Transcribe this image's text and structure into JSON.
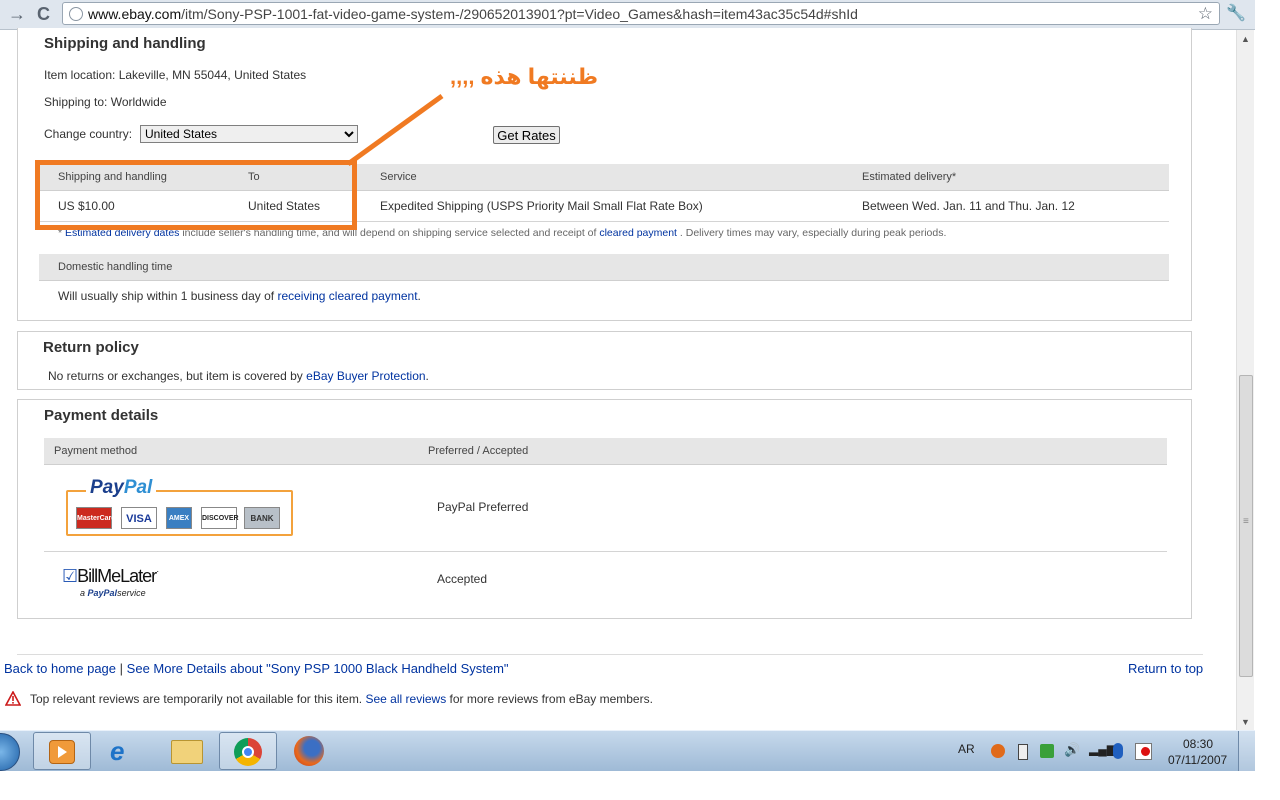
{
  "browser": {
    "url_host": "www.ebay.com",
    "url_path": "/itm/Sony-PSP-1001-fat-video-game-system-/290652013901?pt=Video_Games&hash=item43ac35c54d#shId",
    "back_glyph": "→",
    "reload_glyph": "C"
  },
  "shipping": {
    "title": "Shipping and handling",
    "item_location": "Item location: Lakeville, MN 55044, United States",
    "shipping_to": "Shipping to: Worldwide",
    "change_country_label": "Change country:",
    "selected_country": "United States",
    "get_rates_label": "Get Rates",
    "table": {
      "headers": [
        "Shipping and handling",
        "To",
        "Service",
        "Estimated delivery*"
      ],
      "row": [
        "US $10.00",
        "United States",
        "Expedited Shipping (USPS Priority Mail Small Flat Rate Box)",
        "Between Wed. Jan. 11 and Thu. Jan. 12"
      ]
    },
    "note_star": "*",
    "note_link1": "Estimated delivery dates",
    "note_mid": "include seller's handling time, and will depend on shipping service selected and receipt of",
    "note_link2": "cleared payment",
    "note_end": ". Delivery times may vary, especially during peak periods.",
    "domestic_header": "Domestic handling time",
    "domestic_text": "Will usually ship within 1 business day of",
    "domestic_link": "receiving cleared payment",
    "domestic_end": "."
  },
  "annotation": {
    "text": "ظننتها هذه ,,,,",
    "color": "#f07a22"
  },
  "return_policy": {
    "title": "Return policy",
    "text": "No returns or exchanges, but item is covered by",
    "link": "eBay Buyer Protection",
    "end": "."
  },
  "payment": {
    "title": "Payment details",
    "headers": [
      "Payment method",
      "Preferred / Accepted"
    ],
    "paypal_logo_text_a": "Pay",
    "paypal_logo_text_b": "Pal",
    "cards": [
      "MasterCard",
      "VISA",
      "AMEX",
      "DISCOVER",
      "BANK"
    ],
    "paypal_status": "PayPal Preferred",
    "bml_logo_text": "BillMeLater",
    "bml_sub_a": "a",
    "bml_sub_b": "PayPal",
    "bml_sub_c": "service",
    "bml_status": "Accepted"
  },
  "footer": {
    "back_home": "Back to home page",
    "separator": "|",
    "see_more": "See More Details about \"Sony PSP 1000 Black Handheld System\"",
    "return_top": "Return to top",
    "reviews_text": "Top relevant reviews are temporarily not available for this item.",
    "reviews_link": "See all reviews",
    "reviews_end": "for more reviews from eBay members."
  },
  "taskbar": {
    "language": "AR",
    "time": "08:30",
    "date": "07/11/2007"
  }
}
